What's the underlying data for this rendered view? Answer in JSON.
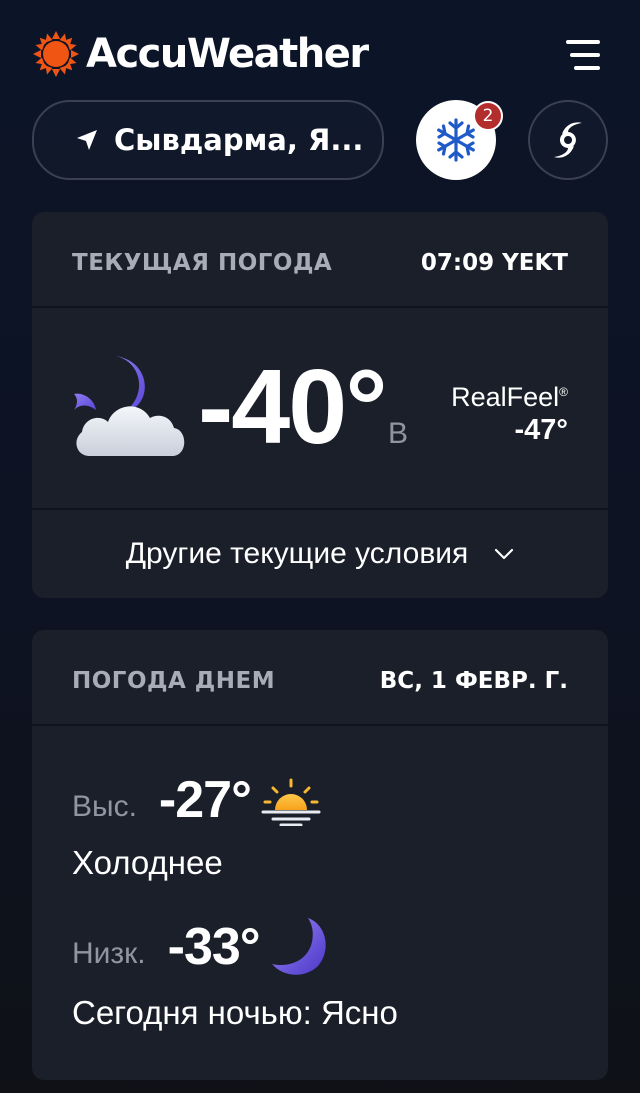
{
  "header": {
    "brand": "AccuWeather",
    "trademark": "."
  },
  "location": {
    "name": "Сывдарма, Я..."
  },
  "alerts": {
    "count": "2",
    "icon": "snowflake-icon"
  },
  "current": {
    "title": "ТЕКУЩАЯ ПОГОДА",
    "time": "07:09 YEKT",
    "temperature": "-40°",
    "wind_direction": "В",
    "realfeel_label": "RealFeel",
    "realfeel_mark": "®",
    "realfeel_value": "-47°",
    "icon": "mostly-cloudy-night-icon",
    "more_label": "Другие текущие условия"
  },
  "daily": {
    "title": "ПОГОДА ДНЕМ",
    "date": "ВС, 1 ФЕВР. Г.",
    "high_label": "Выс.",
    "high_temp": "-27°",
    "high_icon": "sun-haze-icon",
    "day_phrase": "Холоднее",
    "low_label": "Низк.",
    "low_temp": "-33°",
    "low_icon": "moon-icon",
    "night_phrase": "Сегодня ночью: Ясно"
  },
  "colors": {
    "background": "#0d1322",
    "card": "#1b1f2a",
    "brand_orange": "#f05514",
    "alert_blue": "#1f5ac8",
    "badge_red": "#b32d2d"
  }
}
